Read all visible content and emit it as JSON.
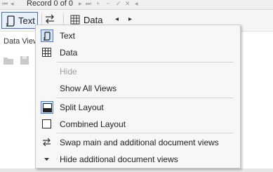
{
  "navigator": {
    "record_label": "Record 0 of 0",
    "first_glyph": "⏮",
    "prev_glyph": "◂",
    "next_glyph": "▸",
    "last_glyph": "⏭",
    "add_glyph": "+",
    "delete_glyph": "−",
    "apply_glyph": "✓",
    "cancel_glyph": "✕",
    "more_glyph": "◂"
  },
  "toolbar": {
    "text_label": "Text",
    "data_label": "Data",
    "prev_glyph": "◂",
    "next_glyph": "▸"
  },
  "background": {
    "data_view_label": "Data View"
  },
  "menu": {
    "items": [
      {
        "label": "Text",
        "icon": "text-view-icon",
        "checked": true,
        "enabled": true
      },
      {
        "label": "Data",
        "icon": "data-grid-icon",
        "checked": false,
        "enabled": true
      },
      {
        "label": "Hide",
        "icon": "",
        "checked": false,
        "enabled": false
      },
      {
        "label": "Show All Views",
        "icon": "",
        "checked": false,
        "enabled": true
      },
      {
        "label": "Split Layout",
        "icon": "split-layout-icon",
        "checked": true,
        "enabled": true
      },
      {
        "label": "Combined Layout",
        "icon": "combined-layout-icon",
        "checked": false,
        "enabled": true
      },
      {
        "label": "Swap main and additional document views",
        "icon": "swap-icon",
        "checked": false,
        "enabled": true
      },
      {
        "label": "Hide additional document views",
        "icon": "triangle-down-icon",
        "checked": false,
        "enabled": true
      }
    ]
  },
  "colors": {
    "accent": "#3d6fc6",
    "checked_bg": "#d5e4f5",
    "disabled_text": "#9e9e9e"
  }
}
